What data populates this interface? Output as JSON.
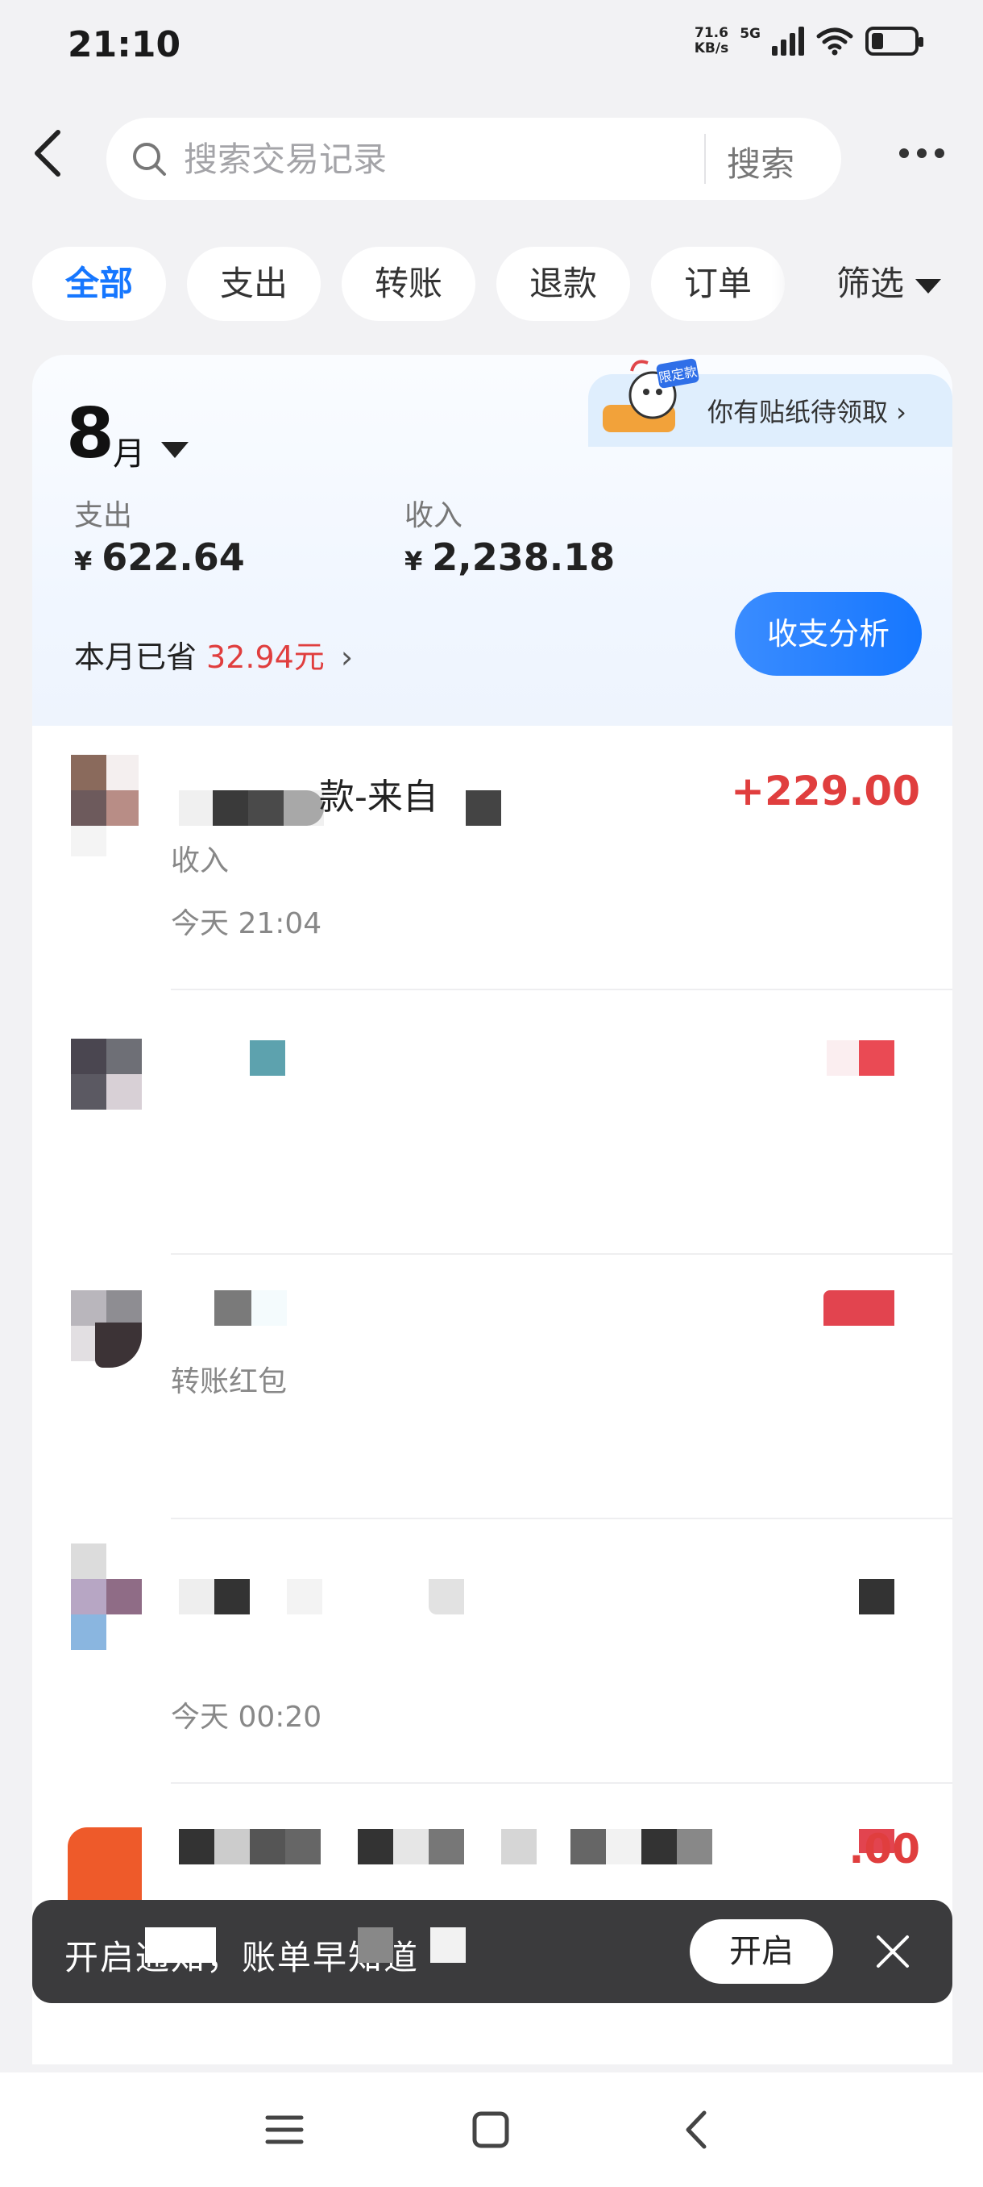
{
  "status": {
    "time": "21:10",
    "net_speed_value": "71.6",
    "net_speed_unit": "KB/s",
    "net_type": "5G"
  },
  "search": {
    "placeholder": "搜索交易记录",
    "submit_label": "搜索"
  },
  "filters": {
    "chips": [
      "全部",
      "支出",
      "转账",
      "退款",
      "订单"
    ],
    "active": "全部",
    "filter_label": "筛选"
  },
  "summary": {
    "month_number": "8",
    "month_unit": "月",
    "sticker_text": "你有贴纸待领取 ›",
    "expense_label": "支出",
    "expense_currency": "¥",
    "expense_value": "622.64",
    "income_label": "收入",
    "income_currency": "¥",
    "income_value": "2,238.18",
    "saved_label": "本月已省",
    "saved_value": "32.94元",
    "analysis_button": "收支分析"
  },
  "transactions": [
    {
      "title": "款-来自",
      "amount": "+229.00",
      "category": "收入",
      "time": "今天 21:04"
    },
    {
      "title": "",
      "amount": "",
      "category": "",
      "time": ""
    },
    {
      "title": "",
      "amount": "",
      "category": "转账红包",
      "time": ""
    },
    {
      "title": "",
      "amount": "",
      "category": "",
      "time": "今天 00:20"
    },
    {
      "title": "",
      "amount": ".00",
      "category": "",
      "time": ""
    }
  ],
  "toast": {
    "text": "开启通知，账单早知道",
    "open_button": "开启"
  },
  "colors": {
    "accent": "#1677ff",
    "income_red": "#e03e3e",
    "background": "#f2f2f4"
  }
}
